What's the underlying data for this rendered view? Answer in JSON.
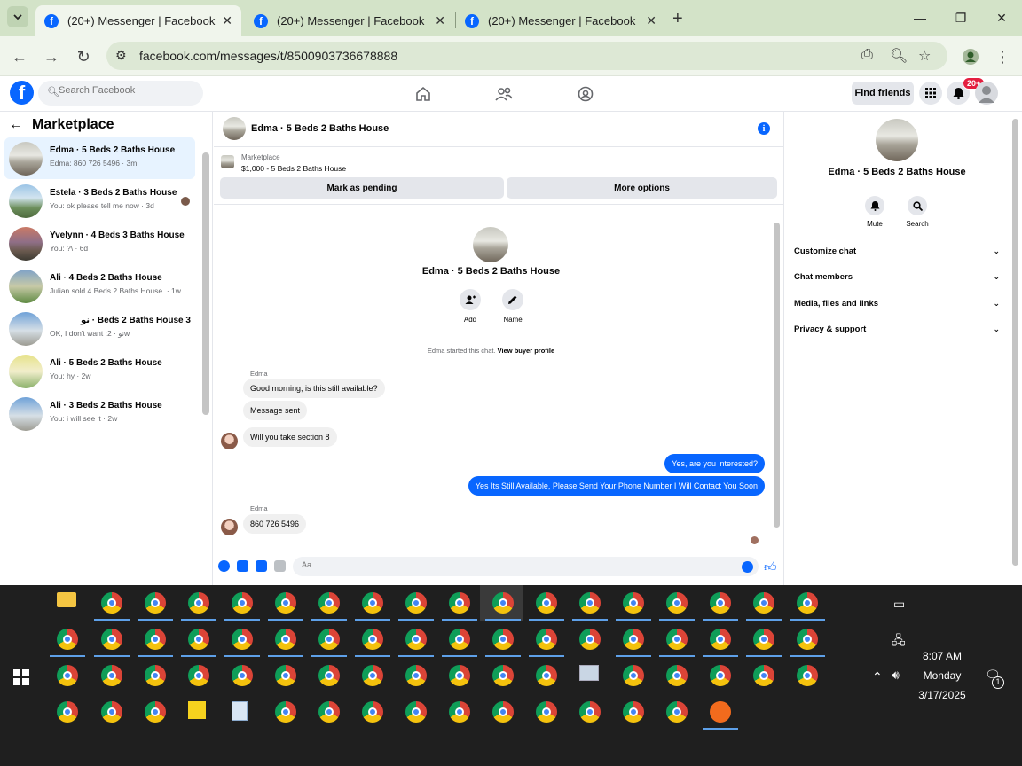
{
  "browser": {
    "tabs": [
      {
        "title": "(20+) Messenger | Facebook",
        "active": true
      },
      {
        "title": "(20+) Messenger | Facebook",
        "active": false
      },
      {
        "title": "(20+) Messenger | Facebook",
        "active": false
      }
    ],
    "url": "facebook.com/messages/t/8500903736678888"
  },
  "fb_header": {
    "search_placeholder": "Search Facebook",
    "find_friends": "Find friends",
    "notif_count": "20+"
  },
  "sidebar": {
    "title": "Marketplace",
    "chats": [
      {
        "name": "Edma · 5 Beds 2 Baths House",
        "preview": "Edma: 860 726 5496 · 3m",
        "selected": true
      },
      {
        "name": "Estela · 3 Beds 2 Baths House",
        "preview": "You: ok please tell me now · 3d",
        "selected": false
      },
      {
        "name": "Yvelynn · 4 Beds 3 Baths House",
        "preview": "You: ?\\ · 6d",
        "selected": false
      },
      {
        "name": "Ali · 4 Beds 2 Baths House",
        "preview": "Julian sold 4 Beds 2 Baths House. · 1w",
        "selected": false
      },
      {
        "name": "نو · Beds 2 Baths House 3",
        "preview": "OK, I don't want :نو · 2w",
        "selected": false
      },
      {
        "name": "Ali · 5 Beds 2 Baths House",
        "preview": "You: hy · 2w",
        "selected": false
      },
      {
        "name": "Ali · 3 Beds 2 Baths House",
        "preview": "You: i will see it · 2w",
        "selected": false
      }
    ]
  },
  "conversation": {
    "title": "Edma · 5 Beds 2 Baths House",
    "marketplace_label": "Marketplace",
    "listing": "$1,000 - 5 Beds 2 Baths House",
    "mark_pending": "Mark as pending",
    "more_options": "More options",
    "profile_name": "Edma · 5 Beds 2 Baths House",
    "add_label": "Add",
    "name_label": "Name",
    "started_text": "Edma started this chat.",
    "buyer_profile_link": "View buyer profile",
    "sender1": "Edma",
    "msg1": "Good morning, is this still available?",
    "msg2": "Message sent",
    "msg3": "Will you take section 8",
    "out1": "Yes, are you interested?",
    "out2": "Yes Its Still Available, Please Send Your Phone Number I Will Contact You Soon",
    "sender2": "Edma",
    "msg4": "860 726 5496",
    "composer_placeholder": "Aa"
  },
  "details": {
    "name": "Edma · 5 Beds 2 Baths House",
    "mute": "Mute",
    "search": "Search",
    "menu": [
      "Customize chat",
      "Chat members",
      "Media, files and links",
      "Privacy & support"
    ]
  },
  "taskbar": {
    "time": "8:07 AM",
    "day": "Monday",
    "date": "3/17/2025",
    "notification_count": "1"
  }
}
